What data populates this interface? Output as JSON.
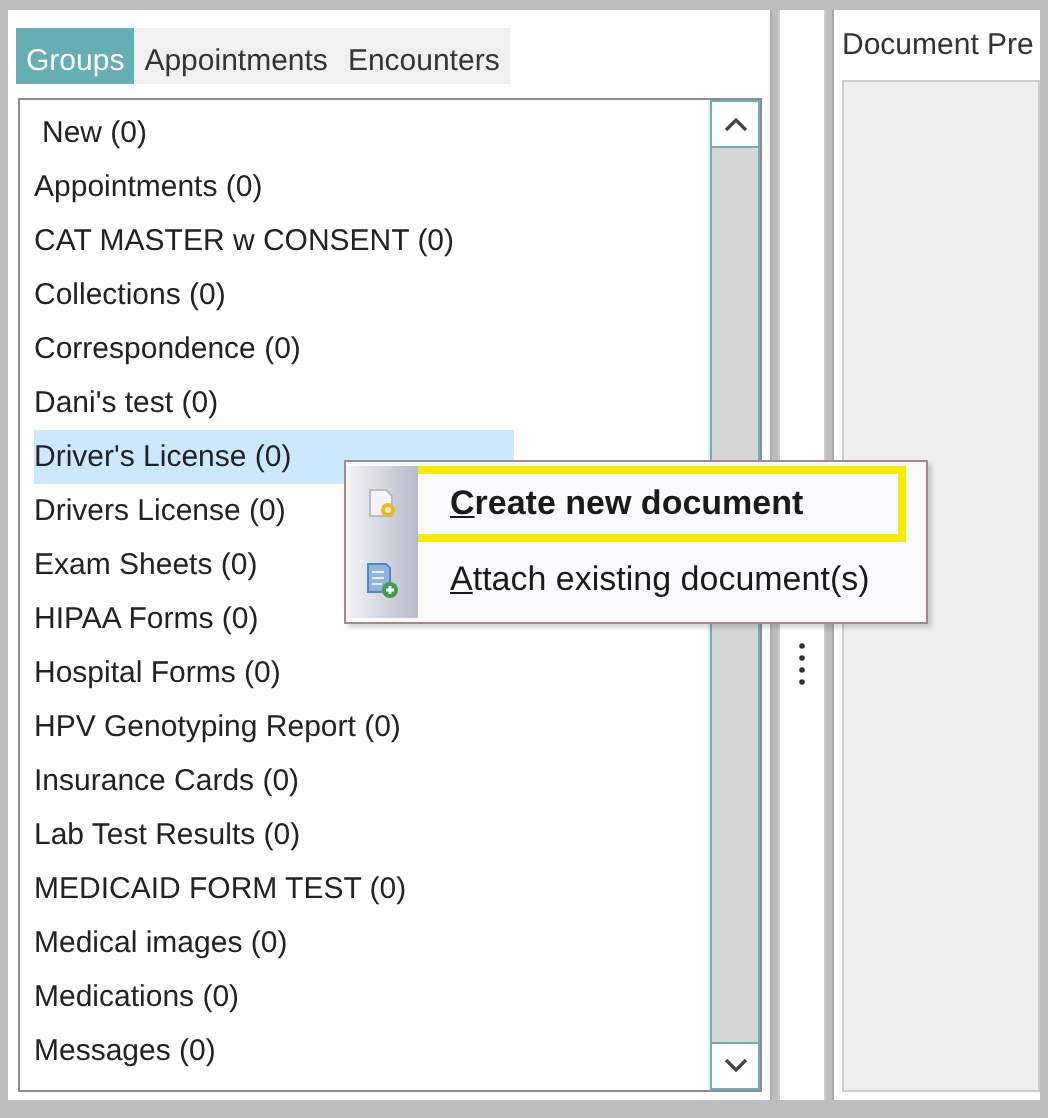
{
  "tabs": [
    {
      "label": "Groups",
      "selected": true
    },
    {
      "label": "Appointments",
      "selected": false
    },
    {
      "label": "Encounters",
      "selected": false
    }
  ],
  "groups": [
    {
      "label": "New (0)",
      "selected": false
    },
    {
      "label": "Appointments (0)",
      "selected": false
    },
    {
      "label": "CAT MASTER w CONSENT (0)",
      "selected": false
    },
    {
      "label": "Collections (0)",
      "selected": false
    },
    {
      "label": "Correspondence (0)",
      "selected": false
    },
    {
      "label": "Dani's test (0)",
      "selected": false
    },
    {
      "label": "Driver's License (0)",
      "selected": true
    },
    {
      "label": "Drivers License (0)",
      "selected": false
    },
    {
      "label": "Exam Sheets (0)",
      "selected": false
    },
    {
      "label": "HIPAA Forms (0)",
      "selected": false
    },
    {
      "label": "Hospital Forms (0)",
      "selected": false
    },
    {
      "label": "HPV Genotyping Report (0)",
      "selected": false
    },
    {
      "label": "Insurance Cards (0)",
      "selected": false
    },
    {
      "label": "Lab Test Results (0)",
      "selected": false
    },
    {
      "label": "MEDICAID FORM TEST (0)",
      "selected": false
    },
    {
      "label": "Medical images (0)",
      "selected": false
    },
    {
      "label": "Medications (0)",
      "selected": false
    },
    {
      "label": "Messages (0)",
      "selected": false
    }
  ],
  "context_menu": [
    {
      "label": "Create new document",
      "access_key_underlined": true,
      "default": true,
      "highlighted": true
    },
    {
      "label": "Attach existing document(s)",
      "access_key_underlined": true,
      "default": false,
      "highlighted": false
    }
  ],
  "preview": {
    "title": "Document Pre"
  }
}
